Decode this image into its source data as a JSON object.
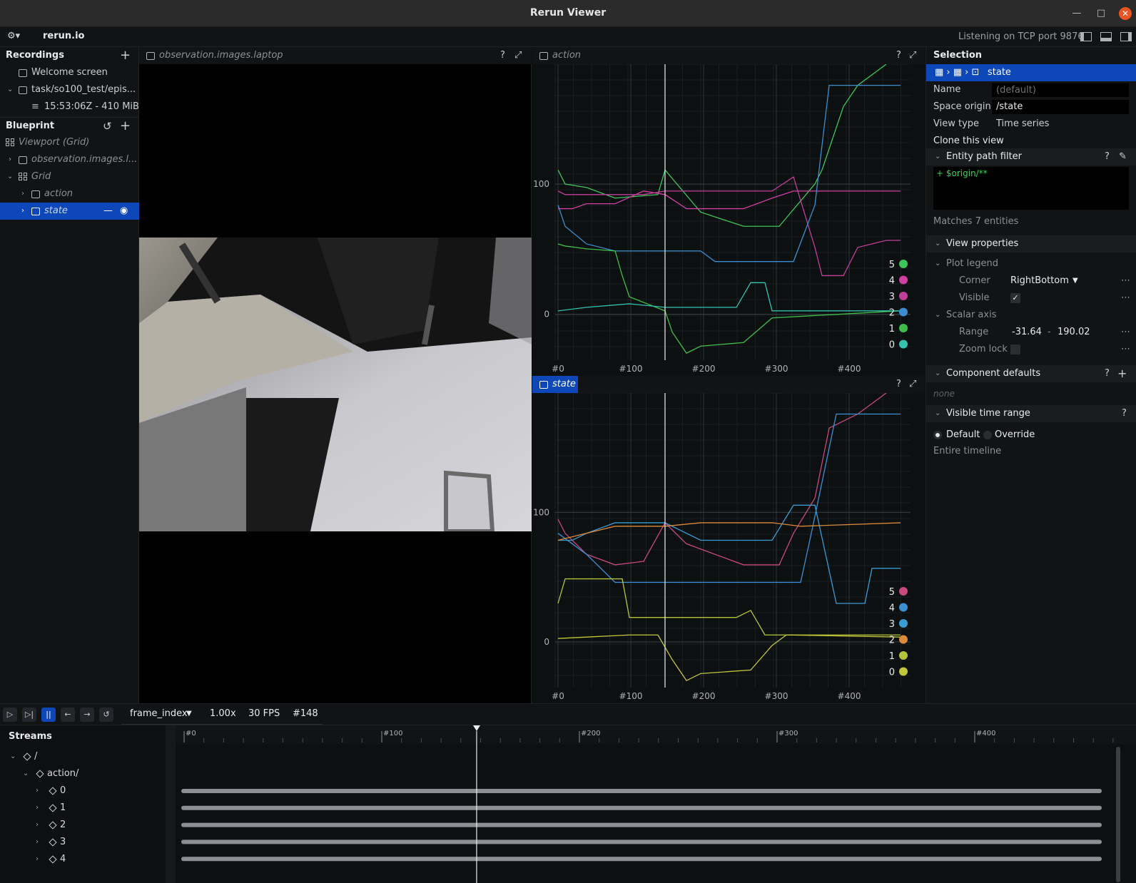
{
  "window": {
    "title": "Rerun Viewer"
  },
  "topbar": {
    "brand": "rerun.io",
    "status": "Listening on TCP port 9876"
  },
  "recordings": {
    "title": "Recordings",
    "items": [
      "Welcome screen",
      "task/so100_test/epis...",
      "15:53:06Z - 410 MiB"
    ]
  },
  "blueprint": {
    "title": "Blueprint",
    "items": [
      "Viewport (Grid)",
      "observation.images.l...",
      "Grid",
      "action",
      "state"
    ]
  },
  "views": {
    "image_title": "observation.images.laptop",
    "action_title": "action",
    "state_title": "state",
    "help": "?"
  },
  "plots": {
    "action": {
      "xticks": [
        "#0",
        "#100",
        "#200",
        "#300",
        "#400"
      ],
      "yticks": [
        "100",
        "0"
      ],
      "legend": [
        {
          "label": "5",
          "color": "#3cc65a"
        },
        {
          "label": "4",
          "color": "#d13fa3"
        },
        {
          "label": "3",
          "color": "#c13f9a"
        },
        {
          "label": "2",
          "color": "#3b8ed0"
        },
        {
          "label": "1",
          "color": "#3fbf4a"
        },
        {
          "label": "0",
          "color": "#33c2b0"
        }
      ]
    },
    "state": {
      "xticks": [
        "#0",
        "#100",
        "#200",
        "#300",
        "#400"
      ],
      "yticks": [
        "100",
        "0"
      ],
      "legend": [
        {
          "label": "5",
          "color": "#c8497f"
        },
        {
          "label": "4",
          "color": "#3d8fd6"
        },
        {
          "label": "3",
          "color": "#3a9bd4"
        },
        {
          "label": "2",
          "color": "#d98a3a"
        },
        {
          "label": "1",
          "color": "#b6c43a"
        },
        {
          "label": "0",
          "color": "#c4c63a"
        }
      ]
    }
  },
  "selection": {
    "title": "Selection",
    "crumb": "state",
    "name_label": "Name",
    "name_placeholder": "(default)",
    "origin_label": "Space origin",
    "origin_value": "/state",
    "viewtype_label": "View type",
    "viewtype_value": "Time series",
    "clone": "Clone this view",
    "entity_filter_title": "Entity path filter",
    "entity_filter_expr": "+ $origin/**",
    "matches": "Matches 7 entities",
    "view_props_title": "View properties",
    "plot_legend": "Plot legend",
    "corner_label": "Corner",
    "corner_value": "RightBottom",
    "visible_label": "Visible",
    "scalar_axis": "Scalar axis",
    "range_label": "Range",
    "range_min": "-31.64",
    "range_sep": "-",
    "range_max": "190.02",
    "zoom_lock": "Zoom lock",
    "component_defaults": "Component defaults",
    "none": "none",
    "visible_time_range": "Visible time range",
    "default_opt": "Default",
    "override_opt": "Override",
    "entire_timeline": "Entire timeline"
  },
  "timeline": {
    "timeline_name": "frame_index",
    "speed": "1.00x",
    "fps": "30 FPS",
    "frame": "#148",
    "ticks": [
      "#0",
      "#100",
      "#200",
      "#300",
      "#400"
    ],
    "streams_title": "Streams",
    "rows": [
      "/",
      "action/",
      "0",
      "1",
      "2",
      "3",
      "4"
    ]
  }
}
